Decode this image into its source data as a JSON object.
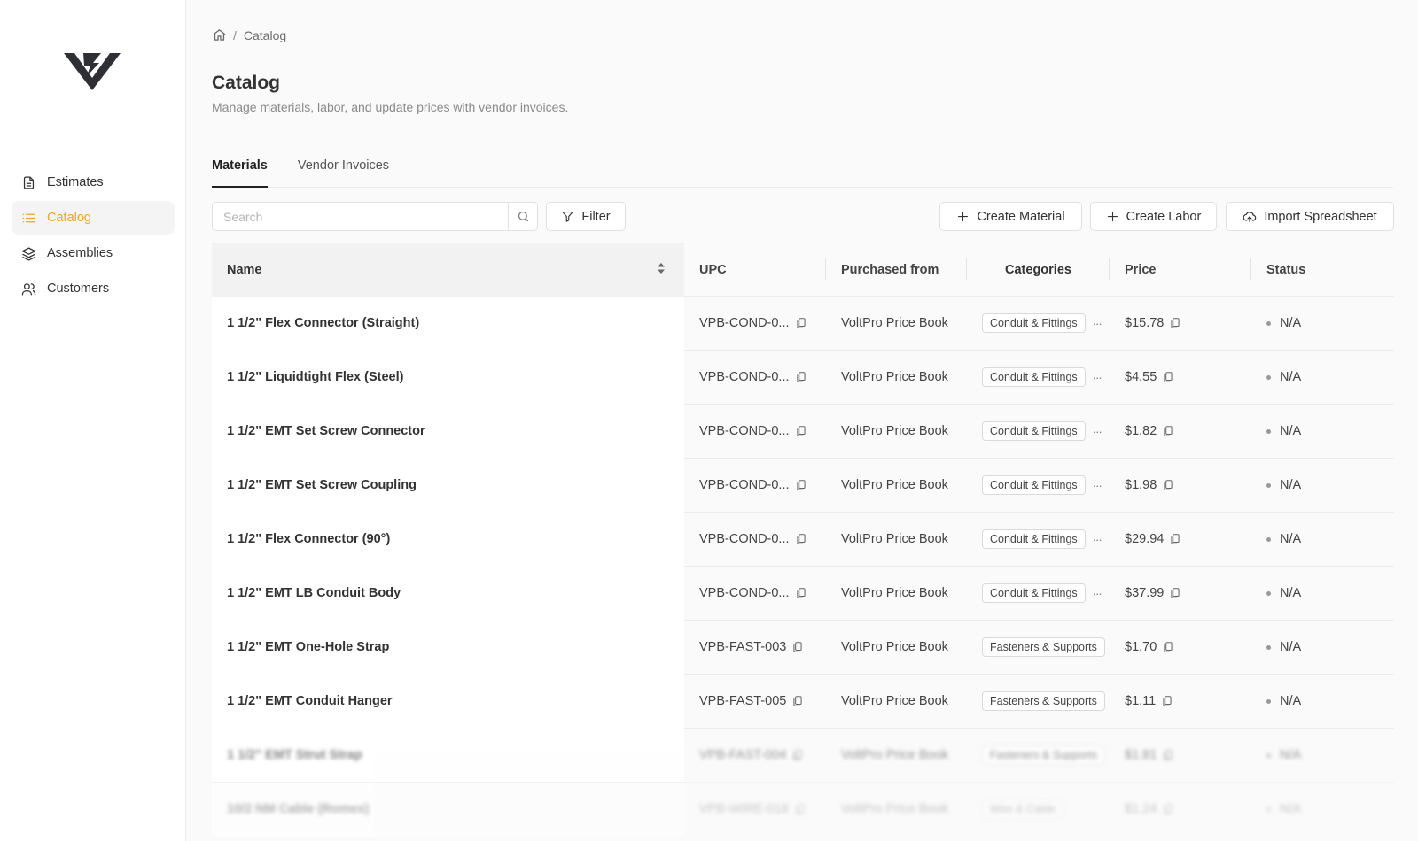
{
  "sidebar": {
    "logo": "voltpro-logo",
    "items": [
      {
        "label": "Estimates",
        "icon": "document-icon"
      },
      {
        "label": "Catalog",
        "icon": "list-icon",
        "active": true
      },
      {
        "label": "Assemblies",
        "icon": "layers-icon"
      },
      {
        "label": "Customers",
        "icon": "users-icon"
      }
    ]
  },
  "breadcrumb": {
    "home_icon": "home-icon",
    "separator": "/",
    "current": "Catalog"
  },
  "header": {
    "title": "Catalog",
    "subtitle": "Manage materials, labor, and update prices with vendor invoices."
  },
  "tabs": [
    {
      "label": "Materials",
      "active": true
    },
    {
      "label": "Vendor Invoices"
    }
  ],
  "toolbar": {
    "search_placeholder": "Search",
    "filter_label": "Filter",
    "create_material_label": "Create Material",
    "create_labor_label": "Create Labor",
    "import_label": "Import Spreadsheet"
  },
  "table": {
    "columns": [
      "Name",
      "UPC",
      "Purchased from",
      "Categories",
      "Price",
      "Status"
    ],
    "rows": [
      {
        "name": "1 1/2\" Flex Connector (Straight)",
        "upc": "VPB-COND-0...",
        "from": "VoltPro Price Book",
        "category": "Conduit & Fittings",
        "more": "···",
        "price": "$15.78",
        "status": "N/A"
      },
      {
        "name": "1 1/2\" Liquidtight Flex (Steel)",
        "upc": "VPB-COND-0...",
        "from": "VoltPro Price Book",
        "category": "Conduit & Fittings",
        "more": "···",
        "price": "$4.55",
        "status": "N/A"
      },
      {
        "name": "1 1/2\" EMT Set Screw Connector",
        "upc": "VPB-COND-0...",
        "from": "VoltPro Price Book",
        "category": "Conduit & Fittings",
        "more": "···",
        "price": "$1.82",
        "status": "N/A"
      },
      {
        "name": "1 1/2\" EMT Set Screw Coupling",
        "upc": "VPB-COND-0...",
        "from": "VoltPro Price Book",
        "category": "Conduit & Fittings",
        "more": "···",
        "price": "$1.98",
        "status": "N/A"
      },
      {
        "name": "1 1/2\" Flex Connector (90°)",
        "upc": "VPB-COND-0...",
        "from": "VoltPro Price Book",
        "category": "Conduit & Fittings",
        "more": "···",
        "price": "$29.94",
        "status": "N/A"
      },
      {
        "name": "1 1/2\" EMT LB Conduit Body",
        "upc": "VPB-COND-0...",
        "from": "VoltPro Price Book",
        "category": "Conduit & Fittings",
        "more": "···",
        "price": "$37.99",
        "status": "N/A"
      },
      {
        "name": "1 1/2\" EMT One-Hole Strap",
        "upc": "VPB-FAST-003",
        "from": "VoltPro Price Book",
        "category": "Fasteners & Supports",
        "more": "",
        "price": "$1.70",
        "status": "N/A"
      },
      {
        "name": "1 1/2\" EMT Conduit Hanger",
        "upc": "VPB-FAST-005",
        "from": "VoltPro Price Book",
        "category": "Fasteners & Supports",
        "more": "",
        "price": "$1.11",
        "status": "N/A"
      },
      {
        "name": "1 1/2\" EMT Strut Strap",
        "upc": "VPB-FAST-004",
        "from": "VoltPro Price Book",
        "category": "Fasteners & Supports",
        "more": "",
        "price": "$1.81",
        "status": "N/A"
      },
      {
        "name": "10/2 NM Cable (Romex)",
        "upc": "VPB-WIRE-018",
        "from": "VoltPro Price Book",
        "category": "Wire & Cable",
        "more": "",
        "price": "$1.24",
        "status": "N/A"
      }
    ]
  }
}
